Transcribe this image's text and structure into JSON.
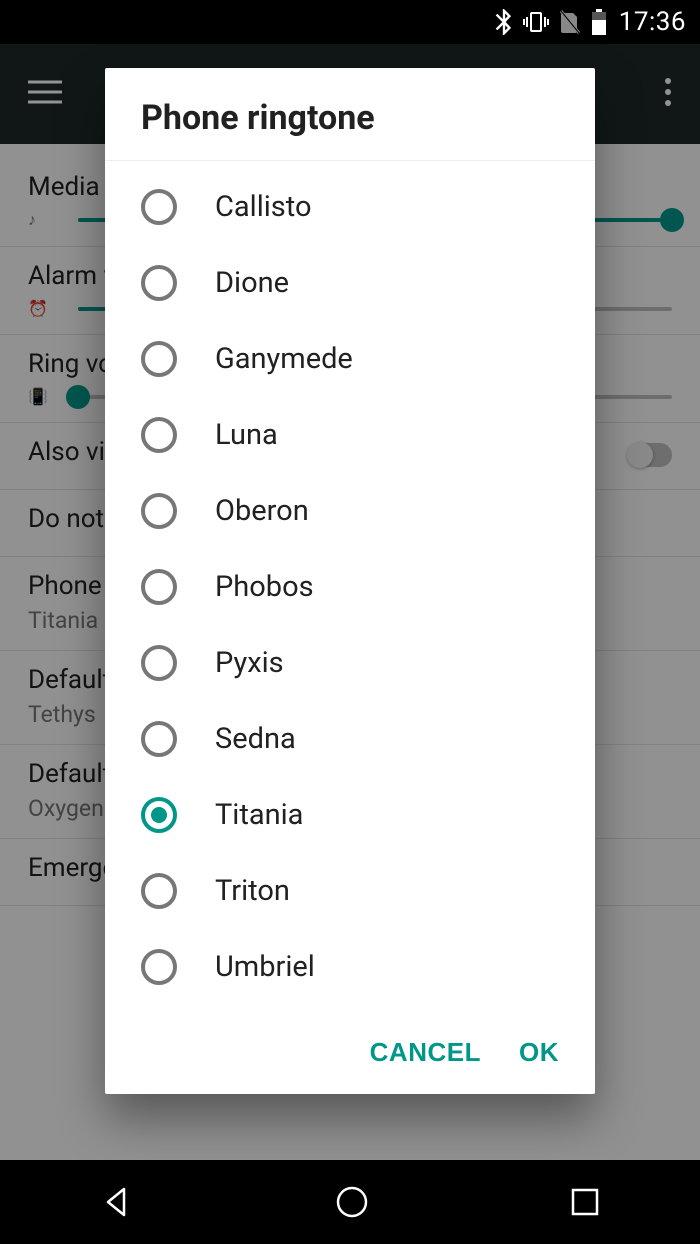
{
  "status": {
    "time": "17:36"
  },
  "settings": {
    "media_label": "Media volume",
    "alarm_label": "Alarm volume",
    "ring_label": "Ring volume",
    "also_vibrate_label": "Also vibrate for calls",
    "dnd_label": "Do not disturb",
    "phone_ringtone_label": "Phone ringtone",
    "phone_ringtone_value": "Titania",
    "default_notif_label": "Default notification ringtone",
    "default_notif_value": "Tethys",
    "default_alarm_label": "Default alarm ringtone",
    "default_alarm_value": "Oxygen",
    "emergency_label": "Emergency broadcasts"
  },
  "dialog": {
    "title": "Phone ringtone",
    "options": [
      {
        "label": "Callisto",
        "selected": false
      },
      {
        "label": "Dione",
        "selected": false
      },
      {
        "label": "Ganymede",
        "selected": false
      },
      {
        "label": "Luna",
        "selected": false
      },
      {
        "label": "Oberon",
        "selected": false
      },
      {
        "label": "Phobos",
        "selected": false
      },
      {
        "label": "Pyxis",
        "selected": false
      },
      {
        "label": "Sedna",
        "selected": false
      },
      {
        "label": "Titania",
        "selected": true
      },
      {
        "label": "Triton",
        "selected": false
      },
      {
        "label": "Umbriel",
        "selected": false
      }
    ],
    "cancel_label": "CANCEL",
    "ok_label": "OK"
  },
  "colors": {
    "accent": "#009688"
  }
}
